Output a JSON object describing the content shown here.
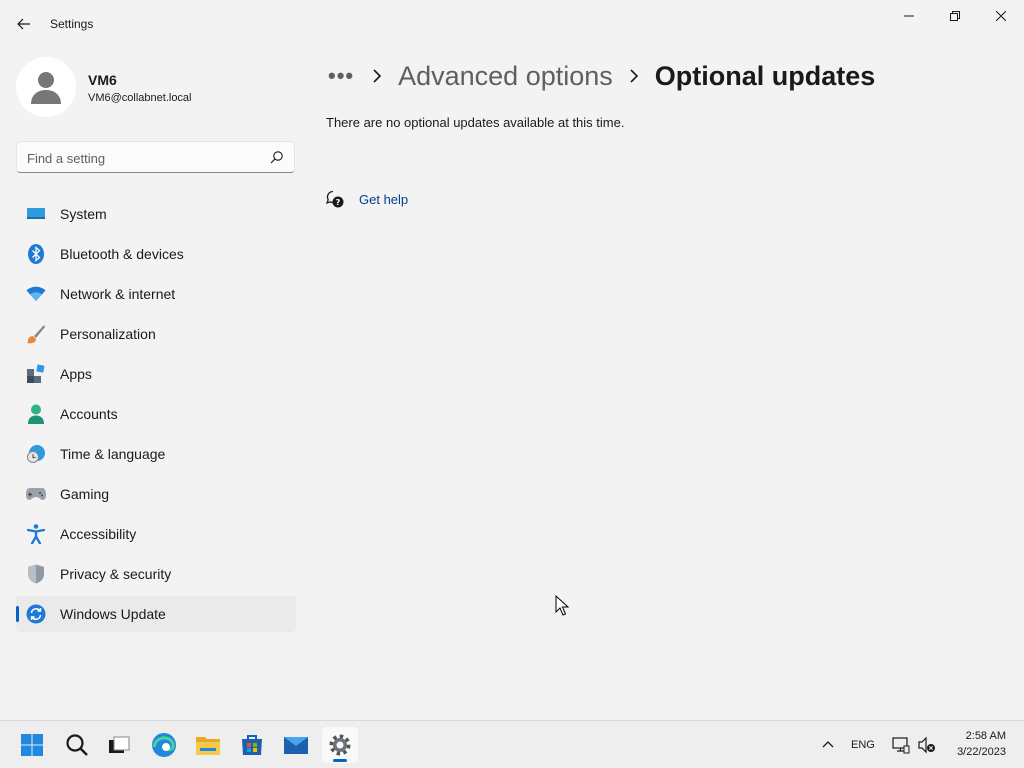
{
  "window": {
    "title": "Settings"
  },
  "profile": {
    "name": "VM6",
    "email": "VM6@collabnet.local"
  },
  "search": {
    "placeholder": "Find a setting",
    "value": ""
  },
  "nav": {
    "items": [
      {
        "label": "System",
        "icon": "system-icon"
      },
      {
        "label": "Bluetooth & devices",
        "icon": "bluetooth-icon"
      },
      {
        "label": "Network & internet",
        "icon": "wifi-icon"
      },
      {
        "label": "Personalization",
        "icon": "brush-icon"
      },
      {
        "label": "Apps",
        "icon": "apps-icon"
      },
      {
        "label": "Accounts",
        "icon": "accounts-icon"
      },
      {
        "label": "Time & language",
        "icon": "time-language-icon"
      },
      {
        "label": "Gaming",
        "icon": "gamepad-icon"
      },
      {
        "label": "Accessibility",
        "icon": "accessibility-icon"
      },
      {
        "label": "Privacy & security",
        "icon": "shield-icon"
      },
      {
        "label": "Windows Update",
        "icon": "windows-update-icon",
        "selected": true
      }
    ]
  },
  "breadcrumb": {
    "more": "•••",
    "previous": "Advanced options",
    "current": "Optional updates"
  },
  "content": {
    "message": "There are no optional updates available at this time.",
    "help_link": "Get help"
  },
  "taskbar": {
    "apps": [
      "start-icon",
      "search-icon",
      "task-view-icon",
      "edge-icon",
      "file-explorer-icon",
      "store-icon",
      "mail-icon",
      "settings-icon"
    ],
    "language": "ENG",
    "time": "2:58 AM",
    "date": "3/22/2023"
  },
  "colors": {
    "accent": "#0067c0",
    "background": "#f3f3f3",
    "link": "#003e92"
  }
}
